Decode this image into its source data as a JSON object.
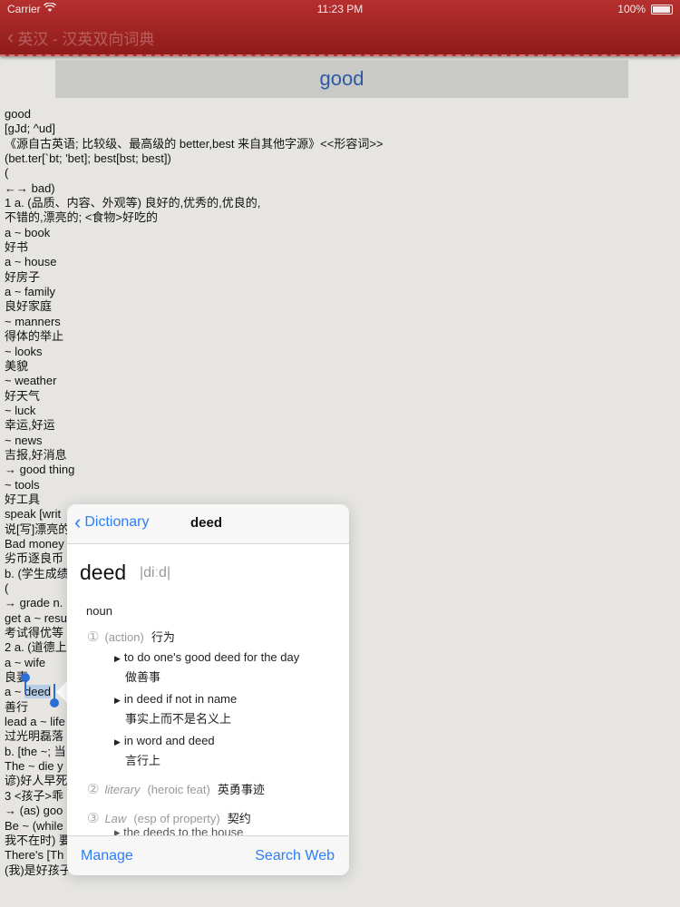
{
  "status_bar": {
    "carrier": "Carrier",
    "time": "11:23 PM",
    "battery": "100%"
  },
  "nav": {
    "back_label": "英汉 - 汉英双向词典"
  },
  "banner": {
    "title": "good"
  },
  "entry_lines": [
    "good",
    "[gJd; ^ud]",
    "《源自古英语; 比较级、最高级的 better,best 来自其他字源》<<形容词>>",
    "(bet.ter[`bt; 'bet]; best[bst; best])",
    "(",
    "←→ bad)",
    "1 a. (品质、内容、外观等) 良好的,优秀的,优良的,",
    "不错的,漂亮的; <食物>好吃的",
    "a ~ book",
    "好书",
    "a ~ house",
    "好房子",
    "a ~ family",
    "良好家庭",
    "~ manners",
    "得体的举止",
    "~ looks",
    "美貌",
    "~ weather",
    "好天气",
    "~ luck",
    "幸运,好运",
    "~ news",
    "吉报,好消息",
    "→ good thing",
    "~ tools",
    "好工具",
    "speak [writ",
    "说[写]漂亮的",
    "Bad money",
    "劣币逐良币",
    "b. (学生成绩",
    "(",
    "→ grade n.",
    "get a ~ resu",
    "考试得优等",
    "2 a. (道德上",
    "a ~ wife",
    "良妻",
    "a ~ ",
    "善行",
    "lead a ~ life",
    "过光明磊落",
    "b. [the ~; 当",
    "The ~ die y",
    "谚)好人早死",
    "3 <孩子>乖",
    "→ (as) goo",
    "Be ~ (while",
    "我不在时) 要",
    "There's [Th",
    "(我)是好孩子"
  ],
  "selection": {
    "word": "deed"
  },
  "popover": {
    "back_label": "Dictionary",
    "title": "deed",
    "headword": "deed",
    "pronunciation": "|diːd|",
    "part_of_speech": "noun",
    "senses": [
      {
        "num": "①",
        "label": "(action)",
        "label2": "",
        "meaning": "行为"
      },
      {
        "num": "②",
        "label": "literary",
        "label2": "(heroic feat)",
        "meaning": "英勇事迹"
      },
      {
        "num": "③",
        "label": "Law",
        "label2": "(esp of property)",
        "meaning": "契约"
      }
    ],
    "examples": [
      {
        "en": "to do one's good deed for the day",
        "cn": "做善事"
      },
      {
        "en": "in deed if not in name",
        "cn": "事实上而不是名义上"
      },
      {
        "en": "in word and deed",
        "cn": "言行上"
      }
    ],
    "cutoff_text": "▸ the deeds to the house",
    "footer": {
      "left": "Manage",
      "right": "Search Web"
    }
  }
}
